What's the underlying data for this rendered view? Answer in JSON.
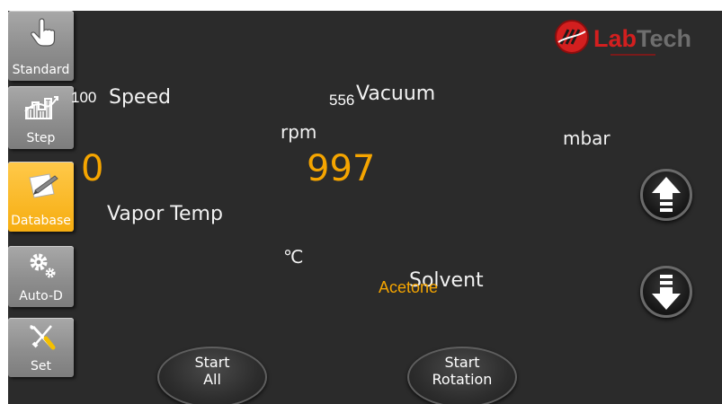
{
  "brand": {
    "name": "LabTech",
    "prefix": "Lab",
    "suffix": "Tech",
    "accent": "#d31f1f"
  },
  "nav": [
    {
      "id": "standard",
      "label": "Standard",
      "icon": "hand-pointer-icon",
      "active": false
    },
    {
      "id": "step",
      "label": "Step",
      "icon": "step-chart-icon",
      "active": false
    },
    {
      "id": "database",
      "label": "Database",
      "icon": "note-pen-icon",
      "active": true
    },
    {
      "id": "auto-d",
      "label": "Auto-D",
      "icon": "gears-icon",
      "active": false
    },
    {
      "id": "set",
      "label": "Set",
      "icon": "tools-icon",
      "active": false
    }
  ],
  "speed": {
    "label": "Speed",
    "setpoint": "100",
    "unit": "rpm",
    "value": "0"
  },
  "vacuum": {
    "label": "Vacuum",
    "setpoint": "556",
    "unit": "mbar",
    "value": "997"
  },
  "vapor_temp": {
    "label": "Vapor Temp",
    "unit": "℃"
  },
  "solvent": {
    "label": "Solvent",
    "value": "Acetone"
  },
  "buttons": {
    "start_all": {
      "line1": "Start",
      "line2": "All"
    },
    "start_rotation": {
      "line1": "Start",
      "line2": "Rotation"
    }
  },
  "colors": {
    "background": "#2b2b2b",
    "value": "#f5a500",
    "nav_active": "#f6ad10",
    "nav": "#8e8e8e"
  }
}
